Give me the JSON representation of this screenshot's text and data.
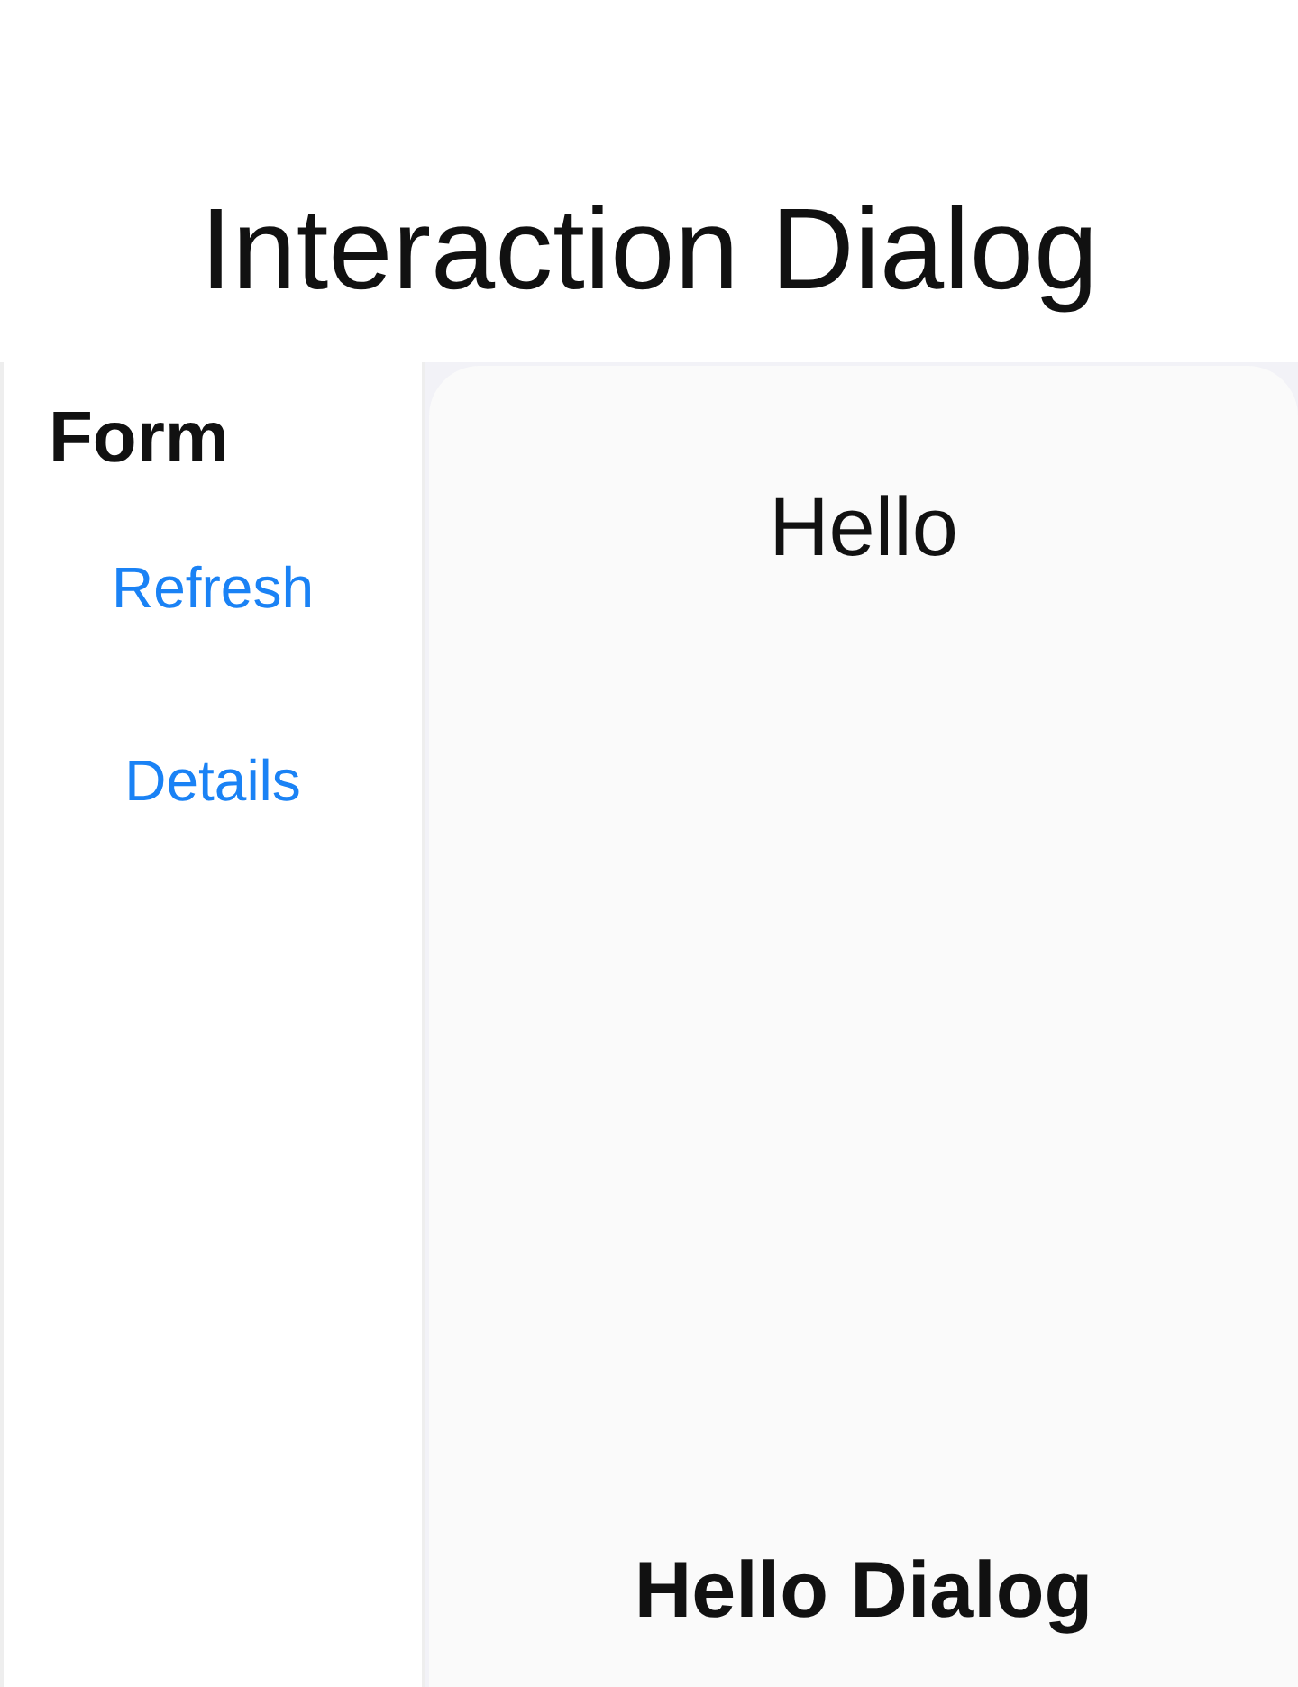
{
  "title": "Interaction Dialog",
  "sidebar": {
    "heading": "Form",
    "links": [
      "Refresh",
      "Details"
    ]
  },
  "dialog": {
    "greeting": "Hello",
    "footer": "Hello Dialog"
  }
}
